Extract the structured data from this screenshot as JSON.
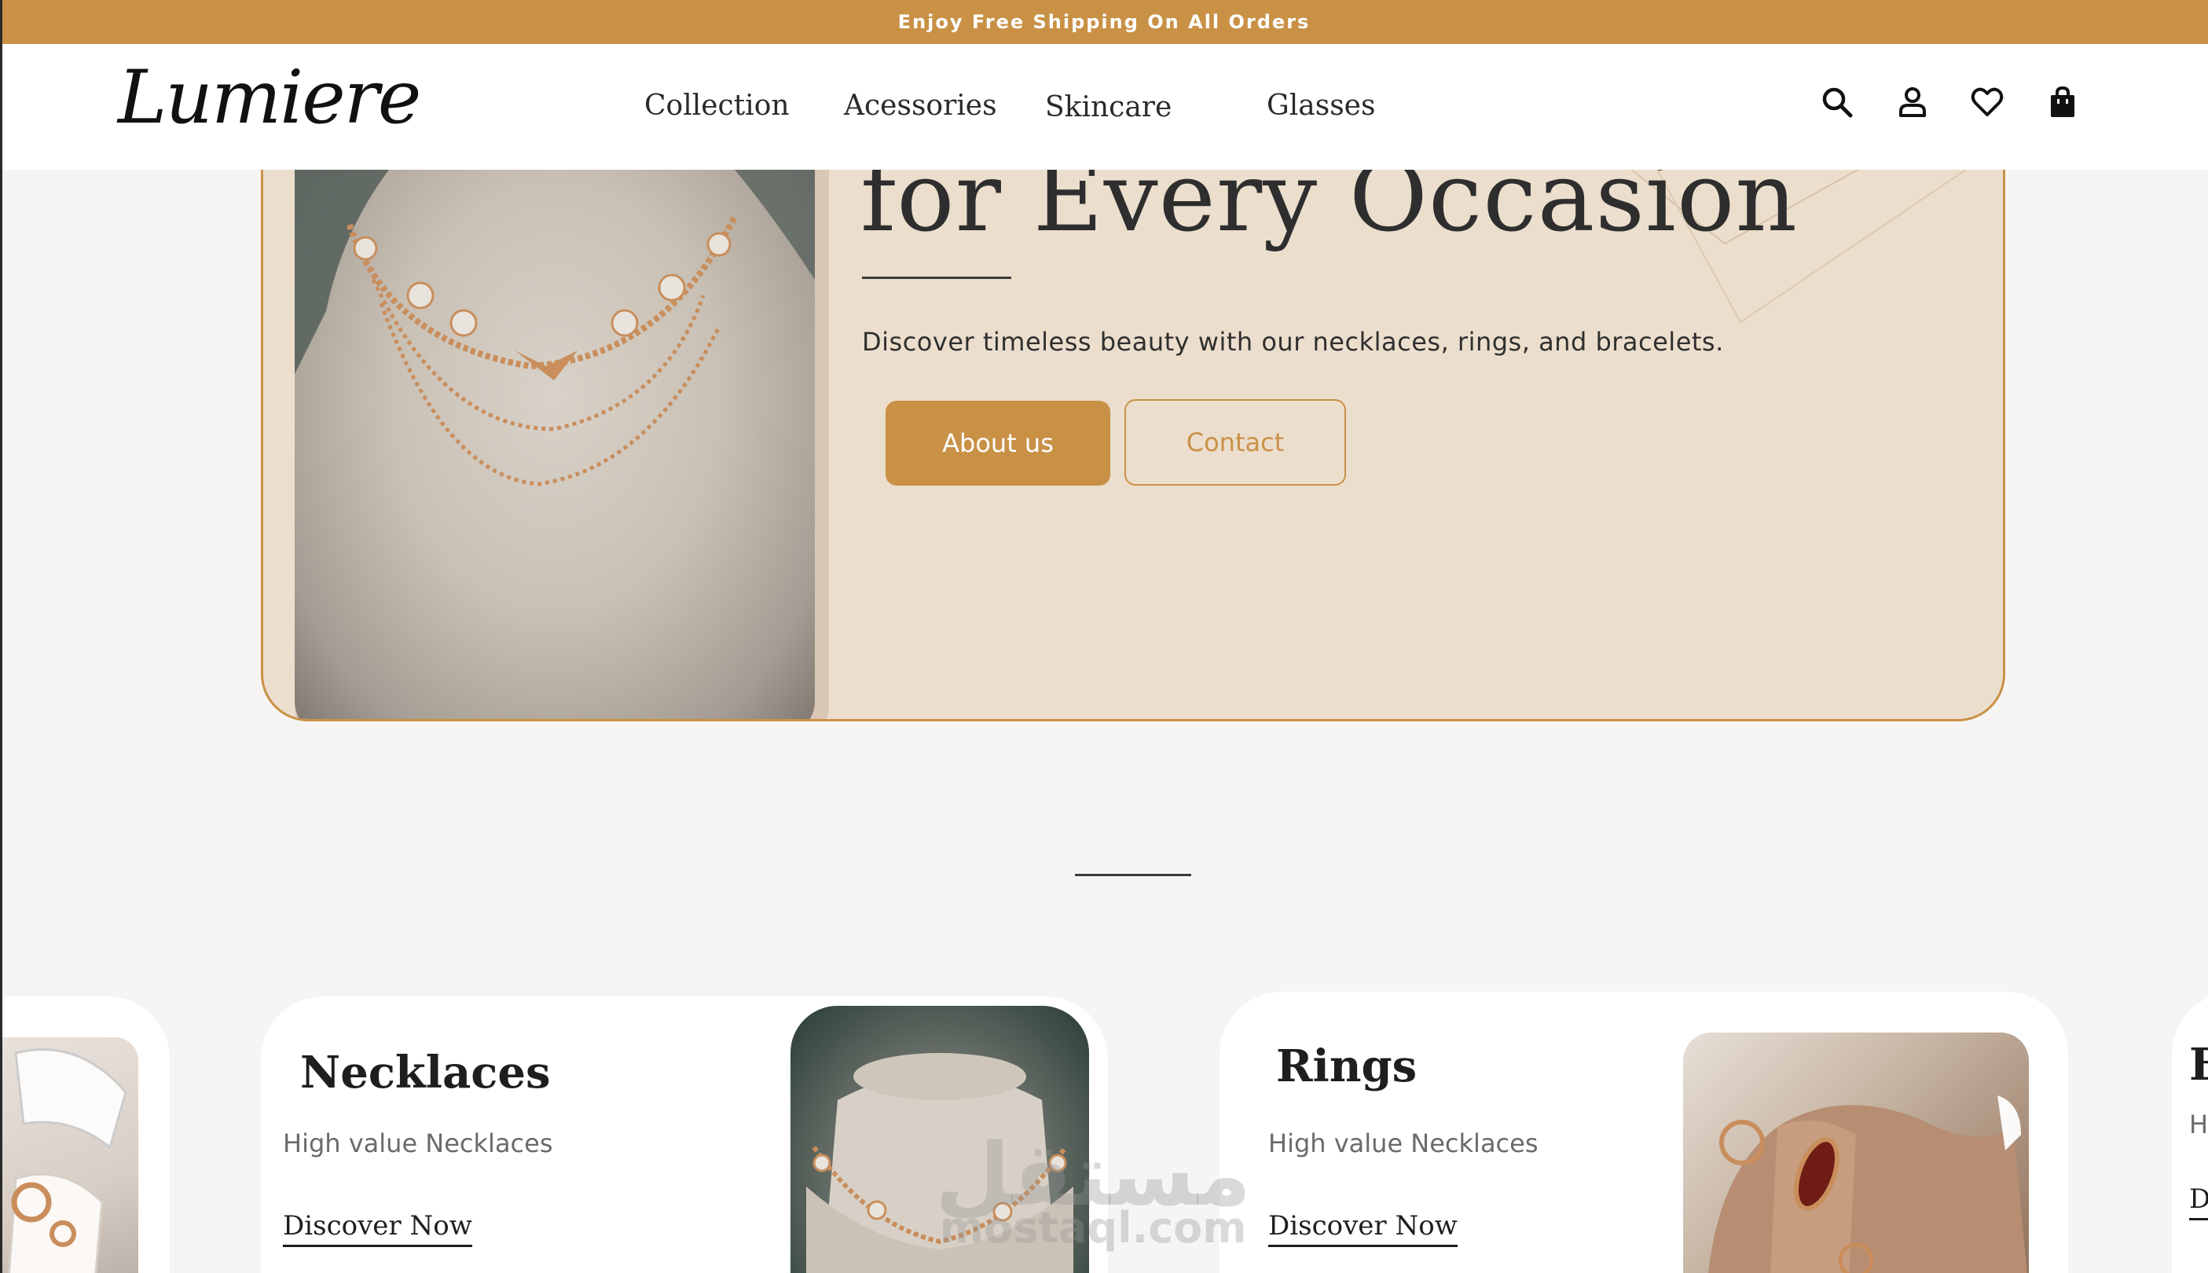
{
  "announcement": {
    "text": "Enjoy Free Shipping On All Orders"
  },
  "header": {
    "logo": "Lumiere",
    "nav": [
      {
        "label": "Collection"
      },
      {
        "label": "Acessories"
      },
      {
        "label": "Skincare"
      },
      {
        "label": "Glasses"
      }
    ],
    "icons": [
      "search-icon",
      "user-icon",
      "heart-icon",
      "shopping-bag-icon"
    ]
  },
  "hero": {
    "title": "for Every Occasion",
    "description": "Discover timeless beauty with our necklaces, rings, and bracelets.",
    "primary_button": "About us",
    "secondary_button": "Contact"
  },
  "categories": [
    {
      "title": "Necklaces",
      "subtitle": "High value Necklaces",
      "link": "Discover Now"
    },
    {
      "title": "Rings",
      "subtitle": "High value Necklaces",
      "link": "Discover Now"
    },
    {
      "title": "B",
      "subtitle": "H",
      "link": "D"
    }
  ],
  "watermark": {
    "arabic": "مستقل",
    "latin": "mostaql.com"
  },
  "colors": {
    "accent": "#c99146",
    "hero_bg": "#ecdecd",
    "page_bg": "#f6f5f3",
    "text": "#2c2c2c"
  }
}
